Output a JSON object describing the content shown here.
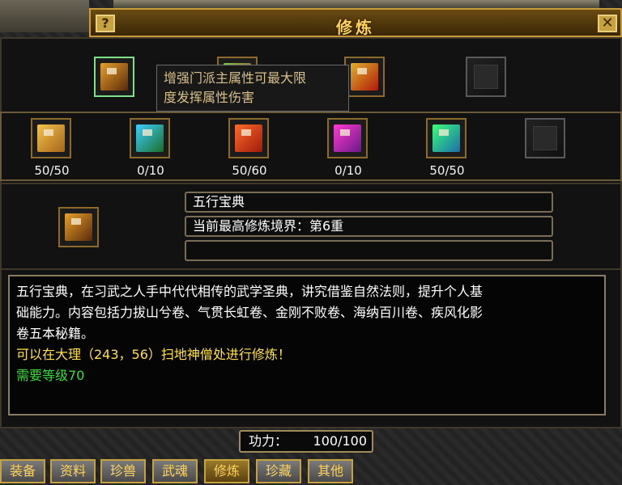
{
  "window": {
    "title": "修炼",
    "help_label": "?",
    "close_label": "✕"
  },
  "skills_row1": [
    {
      "name": "book-fire-five",
      "color": "#c48a2a"
    },
    {
      "name": "book-hidden",
      "color": "#6b5a2a"
    },
    {
      "name": "book-red-gold",
      "color": "#d23a1a"
    },
    {
      "name": "empty",
      "color": ""
    }
  ],
  "tooltip": {
    "line1": "增强门派主属性可最大限",
    "line2": "度发挥属性伤害"
  },
  "skills_row2": [
    {
      "count": "50/50",
      "color": "#e2b23a"
    },
    {
      "count": "0/10",
      "color": "#2bb0d8"
    },
    {
      "count": "50/60",
      "color": "#e0461e"
    },
    {
      "count": "0/10",
      "color": "#cc2aa2"
    },
    {
      "count": "50/50",
      "color": "#2c9f5a"
    },
    {
      "count": "",
      "color": ""
    }
  ],
  "info": {
    "book_name": "五行宝典",
    "highest_level": "当前最高修炼境界：第6重",
    "extra": ""
  },
  "description": {
    "line1": "五行宝典，在习武之人手中代代相传的武学圣典，讲究借鉴自然法则，提升个人基",
    "line2": "础能力。内容包括力拔山兮卷、气贯长虹卷、金刚不败卷、海纳百川卷、疾风化影",
    "line3": "卷五本秘籍。",
    "line4": "可以在大理（243，56）扫地神僧处进行修炼！",
    "line5": "需要等级70"
  },
  "power": {
    "label": "功力：",
    "value": "100/100"
  },
  "tabs": [
    "装备",
    "资料",
    "珍兽",
    "武魂",
    "修炼",
    "珍藏",
    "其他"
  ]
}
